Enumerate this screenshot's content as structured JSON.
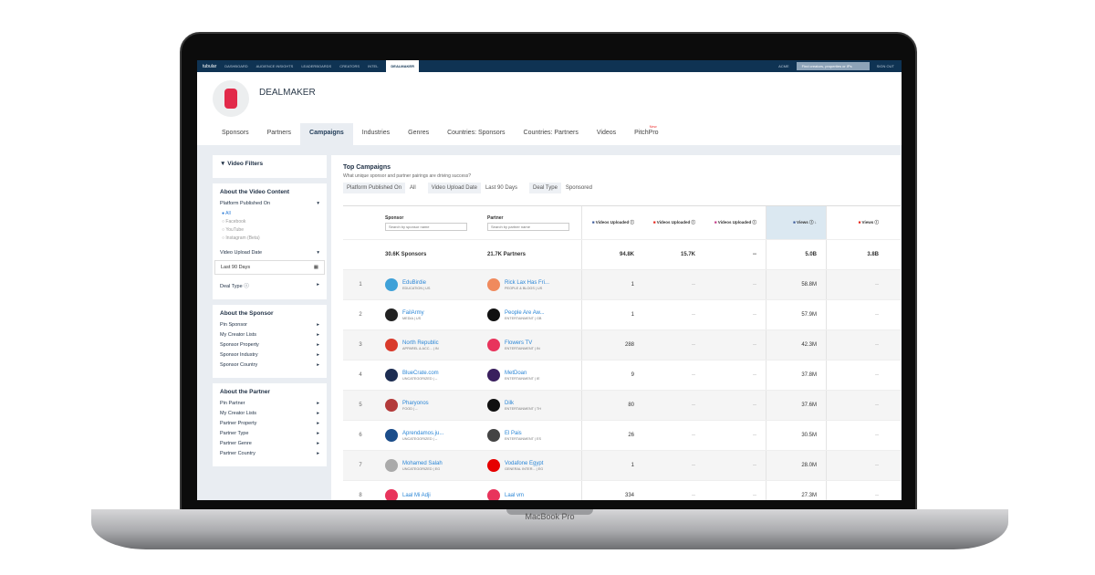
{
  "device": {
    "label": "MacBook Pro"
  },
  "nav": {
    "logo": "tubular",
    "items": [
      "DASHBOARD",
      "AUDIENCE INSIGHTS",
      "LEADERBOARDS",
      "CREATORS",
      "INTEL"
    ],
    "active": "DEALMAKER",
    "new_badge": "New",
    "account": "ACME",
    "search_placeholder": "Find creators, properties or IPs",
    "user": "SIGN OUT"
  },
  "header": {
    "title": "DEALMAKER"
  },
  "tabs": [
    {
      "label": "Sponsors"
    },
    {
      "label": "Partners"
    },
    {
      "label": "Campaigns",
      "active": true
    },
    {
      "label": "Industries"
    },
    {
      "label": "Genres"
    },
    {
      "label": "Countries: Sponsors"
    },
    {
      "label": "Countries: Partners"
    },
    {
      "label": "Videos"
    },
    {
      "label": "PitchPro",
      "badge": "New"
    }
  ],
  "sidebar": {
    "title": "Video Filters",
    "content": {
      "heading": "About the Video Content",
      "platform_label": "Platform Published On",
      "platform_options": [
        "All",
        "Facebook",
        "YouTube",
        "Instagram (Beta)"
      ],
      "selected": "All",
      "upload_label": "Video Upload Date",
      "upload_value": "Last 90 Days",
      "deal_label": "Deal Type"
    },
    "sponsor": {
      "heading": "About the Sponsor",
      "items": [
        "Pin Sponsor",
        "My Creator Lists",
        "Sponsor Property",
        "Sponsor Industry",
        "Sponsor Country"
      ]
    },
    "partner": {
      "heading": "About the Partner",
      "items": [
        "Pin Partner",
        "My Creator Lists",
        "Partner Property",
        "Partner Type",
        "Partner Genre",
        "Partner Country"
      ]
    }
  },
  "main": {
    "title": "Top Campaigns",
    "subtitle": "What unique sponsor and partner pairings are driving success?",
    "chips": [
      {
        "label": "Platform Published On",
        "value": "All"
      },
      {
        "label": "Video Upload Date",
        "value": "Last 90 Days"
      },
      {
        "label": "Deal Type",
        "value": "Sponsored"
      }
    ],
    "columns": {
      "sponsor": "Sponsor",
      "sponsor_ph": "Search by sponsor name",
      "partner": "Partner",
      "partner_ph": "Search by partner name",
      "fb_videos": "Videos Uploaded",
      "yt_videos": "Videos Uploaded",
      "ig_videos": "Videos Uploaded",
      "fb_views": "Views",
      "yt_views": "Views"
    },
    "totals": {
      "sponsors": "30.6K Sponsors",
      "partners": "21.7K Partners",
      "fb_videos": "94.8K",
      "yt_videos": "15.7K",
      "ig_videos": "--",
      "fb_views": "5.0B",
      "yt_views": "3.8B"
    },
    "rows": [
      {
        "rank": "1",
        "sponsor": "EduBirdie",
        "sponsor_meta": "EDUCATION | US",
        "partner": "Rick Lax Has Fri...",
        "partner_meta": "PEOPLE & BLOGS | US",
        "fb_videos": "1",
        "yt_videos": "--",
        "ig_videos": "--",
        "fb_views": "58.8M",
        "yt_views": "--",
        "sc": "#3fa1d8",
        "pc": "#f08a5d"
      },
      {
        "rank": "2",
        "sponsor": "FailArmy",
        "sponsor_meta": "MEDIA | US",
        "partner": "People Are Aw...",
        "partner_meta": "ENTERTAINMENT | GB",
        "fb_videos": "1",
        "yt_videos": "--",
        "ig_videos": "--",
        "fb_views": "57.9M",
        "yt_views": "--",
        "sc": "#222",
        "pc": "#111"
      },
      {
        "rank": "3",
        "sponsor": "North Republic",
        "sponsor_meta": "APPAREL & ACC... | IN",
        "partner": "Flowers TV",
        "partner_meta": "ENTERTAINMENT | IN",
        "fb_videos": "288",
        "yt_videos": "--",
        "ig_videos": "--",
        "fb_views": "42.3M",
        "yt_views": "--",
        "sc": "#d93a2b",
        "pc": "#e8345c"
      },
      {
        "rank": "4",
        "sponsor": "BlueCrate.com",
        "sponsor_meta": "UNCATEGORIZED | --",
        "partner": "MetDoan",
        "partner_meta": "ENTERTAINMENT | IE",
        "fb_videos": "9",
        "yt_videos": "--",
        "ig_videos": "--",
        "fb_views": "37.8M",
        "yt_views": "--",
        "sc": "#1d2d52",
        "pc": "#3a1f5e"
      },
      {
        "rank": "5",
        "sponsor": "Pharyonos",
        "sponsor_meta": "FOOD | --",
        "partner": "Dilk",
        "partner_meta": "ENTERTAINMENT | TH",
        "fb_videos": "80",
        "yt_videos": "--",
        "ig_videos": "--",
        "fb_views": "37.6M",
        "yt_views": "--",
        "sc": "#b33a3a",
        "pc": "#111"
      },
      {
        "rank": "6",
        "sponsor": "Aprendamos.ju...",
        "sponsor_meta": "UNCATEGORIZED | --",
        "partner": "El Pais",
        "partner_meta": "ENTERTAINMENT | ES",
        "fb_videos": "26",
        "yt_videos": "--",
        "ig_videos": "--",
        "fb_views": "30.5M",
        "yt_views": "--",
        "sc": "#1b4d8a",
        "pc": "#444"
      },
      {
        "rank": "7",
        "sponsor": "Mohamed Salah",
        "sponsor_meta": "UNCATEGORIZED | EG",
        "partner": "Vodafone Egypt",
        "partner_meta": "GENERAL INTER... | EG",
        "fb_videos": "1",
        "yt_videos": "--",
        "ig_videos": "--",
        "fb_views": "28.0M",
        "yt_views": "--",
        "sc": "#aaa",
        "pc": "#e60000"
      },
      {
        "rank": "8",
        "sponsor": "Laal Mi Adji",
        "sponsor_meta": "",
        "partner": "Laal vm",
        "partner_meta": "",
        "fb_videos": "334",
        "yt_videos": "--",
        "ig_videos": "--",
        "fb_views": "27.3M",
        "yt_views": "--",
        "sc": "#e8345c",
        "pc": "#e8345c"
      }
    ]
  }
}
